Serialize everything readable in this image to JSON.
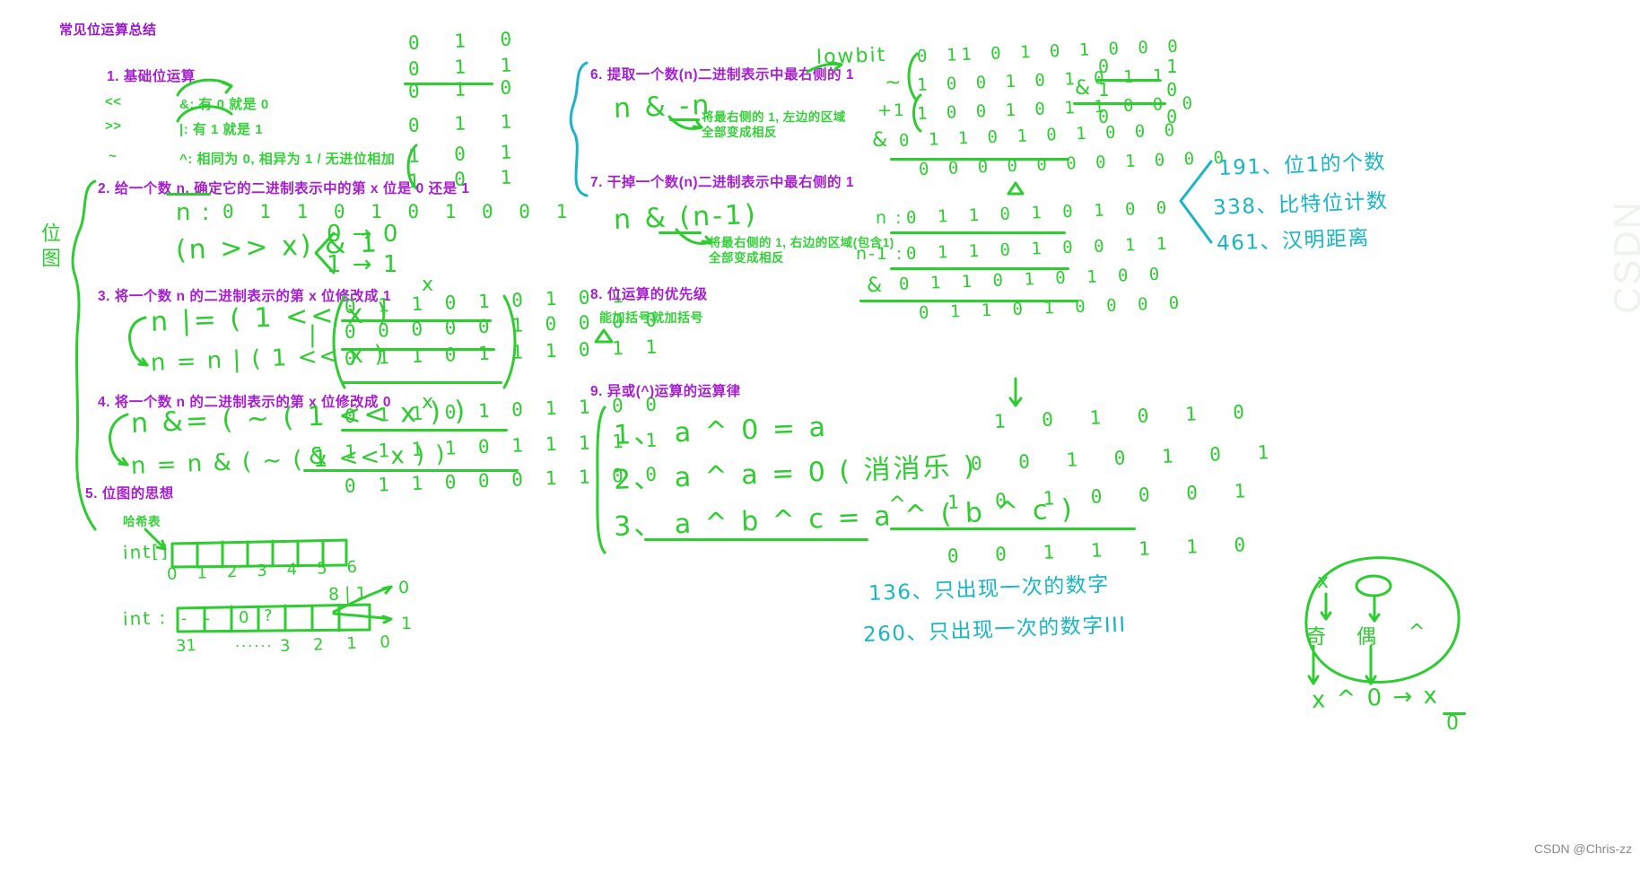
{
  "page": {
    "title": "常见位运算总结",
    "watermark": "CSDN @Chris-zz",
    "watermark_faint": "CSDN"
  },
  "sections": {
    "s1": {
      "heading": "1. 基础位运算",
      "ops": [
        "<<",
        ">>",
        "~"
      ],
      "rules": [
        "&: 有 0 就是 0",
        "|: 有 1 就是 1",
        "^: 相同为 0, 相异为 1 / 无进位相加"
      ],
      "truth_table": {
        "rows": [
          "0  1   0",
          "0  1   1",
          "0  1   0",
          "0  1   1",
          "1  0   1",
          "1  0   1"
        ]
      }
    },
    "s2": {
      "heading": "2. 给一个数 n, 确定它的二进制表示中的第 x 位是 0 还是 1",
      "n_label": "n :",
      "n_bits": "0 1 1 0 1 0 1 0 0 1",
      "formula": "(n >> x) & 1",
      "branch": [
        "0 → 0",
        "1 → 1"
      ]
    },
    "s3": {
      "heading": "3. 将一个数 n 的二进制表示的第 x 位修改成 1",
      "formula1": "n |= ( 1 << x )",
      "formula2": "n = n | ( 1 << x )",
      "marker": "x",
      "calc": {
        "op": "|",
        "row1": "0 1 1 0 1 0 1 0 1",
        "row2": "0 0 0 0 0 1 0 0 0 0",
        "result": "0 1 1 0 1 1 1 0 1 1"
      }
    },
    "s4": {
      "heading": "4. 将一个数 n 的二进制表示的第 x 位修改成 0",
      "formula1": "n &= ( ~ ( 1 << x ) )",
      "formula2": "n = n & ( ~ ( 1 << x ) )",
      "marker": "x",
      "calc": {
        "row1": "0 1 1 0 1 0 1 1 0 0",
        "op": "&",
        "row2": "1 1 1 1 0 1 1 1 1 1",
        "result": "0 1 1 0 0 0 1 1 0 0"
      }
    },
    "s5": {
      "heading": "5. 位图的思想",
      "hash_label": "哈希表",
      "array_label": "int[]",
      "array_index": [
        "0",
        "1",
        "2",
        "3",
        "4",
        "5",
        "6"
      ],
      "int_label": "int :",
      "bit_cells": [
        "-",
        "-",
        "0",
        "?",
        "",
        "",
        "",
        ""
      ],
      "bit_left_number": "31",
      "bit_dots": "......",
      "bit_right_numbers": "3  2  1  0",
      "arrow_top_value": "0",
      "arrow_mid_value": "8 | 1",
      "arrow_bottom_value": "1"
    },
    "s6": {
      "heading": "6. 提取一个数(n)二进制表示中最右侧的 1",
      "lowbit_label": "lowbit",
      "formula": "n & -n",
      "note": "将最右侧的 1, 左边的区域\n全部变成相反",
      "work": {
        "tilde_label": "~",
        "plus_label": "+1",
        "row_n": "0 11 0 1 0 1 0 0 0",
        "row_not": "1 0 0 1 0 1 0 1 1",
        "row_plus": "1 0 0 1 0 1 1 0 0 0",
        "row_and_op": "&",
        "row_and": "0 1 1 0 1 0 1 0 0 0",
        "result": "0 0 0 0 0 0 0 1 0 0 0",
        "mini_table": {
          "top": "0    1",
          "op": "&",
          "mid": "1    0",
          "bottom": "0    0"
        }
      }
    },
    "s7": {
      "heading": "7. 干掉一个数(n)二进制表示中最右侧的 1",
      "formula": "n & (n-1)",
      "note": "将最右侧的 1, 右边的区域(包含1)\n全部变成相反",
      "work": {
        "label_n": "n :",
        "row_n": "0 1 1 0 1 0 1 0 0",
        "label_n1": "n-1 :",
        "row_n1": "0 1 1 0 1 0 0 1 1",
        "op": "&",
        "row_and": "0 1 1 0 1 0 1 0 0",
        "result": "0 1 1 0 1 0 0 0 0"
      }
    },
    "s8": {
      "heading": "8. 位运算的优先级",
      "note": "能加括号就加括号"
    },
    "s9": {
      "heading": "9. 异或(^)运算的运算律",
      "laws": [
        "1、 a ^ 0 = a",
        "2、 a ^ a = 0 ( 消消乐 )",
        "3、 a ^ b ^ c = a ^ ( b ^ c )"
      ],
      "work": {
        "row1": "1 0 1 0 1 0",
        "row2": "0 0 1 0 1 0 1",
        "op": "^",
        "row3": "1 0 1 0 0 0 1",
        "result": "0 0 1 1 1 1 0"
      }
    }
  },
  "blue_notes": {
    "right_group": [
      "191、位1的个数",
      "338、比特位计数",
      "461、汉明距离"
    ],
    "bottom_group": [
      "136、只出现一次的数字",
      "260、只出现一次的数字III"
    ]
  },
  "parity_diagram": {
    "x_label": "x",
    "odd": "奇",
    "even": "偶",
    "caret": "^",
    "formula": "x ^ 0 → x",
    "denominator": "0"
  },
  "colors": {
    "purple": "#a51fd0",
    "green": "#2ecc31",
    "green_text": "#35d03a",
    "blue": "#19b5c4",
    "background": "#ffffff"
  }
}
